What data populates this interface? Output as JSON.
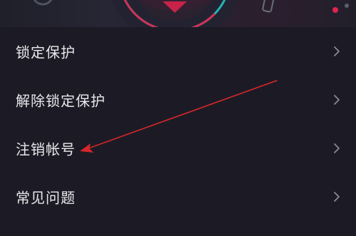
{
  "colors": {
    "background": "#1c1b25",
    "text": "#e8e8ec",
    "chevron": "#8a8a94",
    "annotation_arrow": "#d8262a",
    "banner_accent_cyan": "#23c4c4",
    "banner_accent_red": "#e0244e"
  },
  "banner": {
    "icon": "decorative-banner-graphic"
  },
  "menu": {
    "items": [
      {
        "label": "锁定保护",
        "icon": "chevron-right-icon"
      },
      {
        "label": "解除锁定保护",
        "icon": "chevron-right-icon"
      },
      {
        "label": "注销帐号",
        "icon": "chevron-right-icon"
      },
      {
        "label": "常见问题",
        "icon": "chevron-right-icon"
      }
    ]
  },
  "annotation": {
    "type": "red-arrow",
    "target": "注销帐号"
  }
}
